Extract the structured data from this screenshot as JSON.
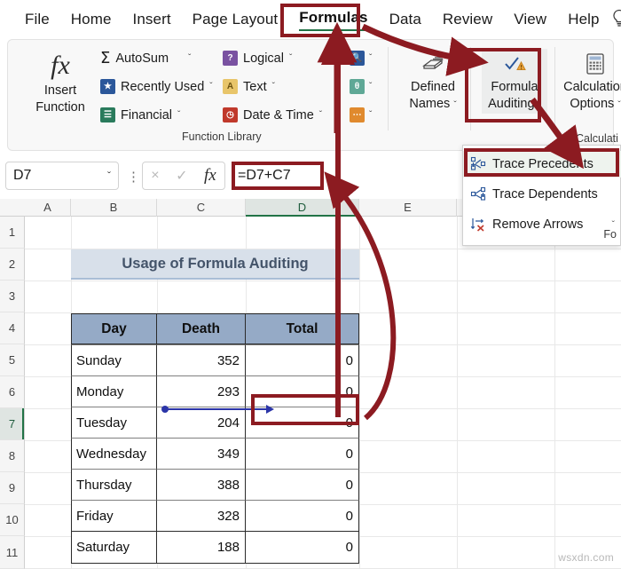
{
  "tabs": [
    {
      "label": "File",
      "active": false
    },
    {
      "label": "Home",
      "active": false
    },
    {
      "label": "Insert",
      "active": false
    },
    {
      "label": "Page Layout",
      "active": false
    },
    {
      "label": "Formulas",
      "active": true
    },
    {
      "label": "Data",
      "active": false
    },
    {
      "label": "Review",
      "active": false
    },
    {
      "label": "View",
      "active": false
    },
    {
      "label": "Help",
      "active": false
    }
  ],
  "help_icon": "lightbulb-icon",
  "ribbon": {
    "insert_function": {
      "line1": "Insert",
      "line2": "Function",
      "icon": "fx-icon"
    },
    "function_library": {
      "group_label": "Function Library",
      "buttons": [
        {
          "label": "AutoSum",
          "icon": "sigma-icon",
          "chevron": "ˇ"
        },
        {
          "label": "Recently Used",
          "icon": "star-icon",
          "chevron": "ˇ"
        },
        {
          "label": "Financial",
          "icon": "financial-icon",
          "chevron": "ˇ"
        },
        {
          "label": "Logical",
          "icon": "logical-icon",
          "chevron": "ˇ"
        },
        {
          "label": "Text",
          "icon": "text-icon",
          "chevron": "ˇ"
        },
        {
          "label": "Date & Time",
          "icon": "datetime-icon",
          "chevron": "ˇ"
        }
      ],
      "icon_only": [
        {
          "icon": "lookup-reference-icon",
          "chevron": "ˇ"
        },
        {
          "icon": "math-trig-icon",
          "chevron": "ˇ"
        },
        {
          "icon": "more-functions-icon",
          "chevron": "ˇ"
        }
      ]
    },
    "defined_names": {
      "line1": "Defined",
      "line2": "Names",
      "chevron": "ˇ",
      "icon": "defined-names-icon"
    },
    "formula_auditing": {
      "line1": "Formula",
      "line2": "Auditing",
      "chevron": "ˇ",
      "icon": "formula-auditing-icon",
      "group_label": "Fo"
    },
    "calculation": {
      "line1": "Calculation",
      "line2": "Options",
      "chevron": "ˇ",
      "icon": "calculator-icon",
      "group_label": "Calculati"
    }
  },
  "menu": {
    "items": [
      {
        "label": "Trace Precedents",
        "icon": "trace-precedents-icon",
        "highlighted": true,
        "chevron": ""
      },
      {
        "label": "Trace Dependents",
        "icon": "trace-dependents-icon",
        "highlighted": false,
        "chevron": ""
      },
      {
        "label": "Remove Arrows",
        "icon": "remove-arrows-icon",
        "highlighted": false,
        "chevron": "ˇ"
      }
    ],
    "footer": "Fo"
  },
  "formula_bar": {
    "name_box": "D7",
    "name_box_chevron": "ˇ",
    "cancel_icon": "×",
    "enter_icon": "✓",
    "fx_icon": "fx",
    "formula": "=D7+C7"
  },
  "grid": {
    "columns": [
      "A",
      "B",
      "C",
      "D",
      "E"
    ],
    "selected_column": "D",
    "rows": [
      "1",
      "2",
      "3",
      "4",
      "5",
      "6",
      "7",
      "8",
      "9",
      "10",
      "11"
    ],
    "selected_row": "7",
    "title_cell": "Usage of Formula Auditing",
    "table_headers": [
      "Day",
      "Death",
      "Total"
    ],
    "table_rows": [
      {
        "day": "Sunday",
        "death": "352",
        "total": "0"
      },
      {
        "day": "Monday",
        "death": "293",
        "total": "0"
      },
      {
        "day": "Tuesday",
        "death": "204",
        "total": "0"
      },
      {
        "day": "Wednesday",
        "death": "349",
        "total": "0"
      },
      {
        "day": "Thursday",
        "death": "388",
        "total": "0"
      },
      {
        "day": "Friday",
        "death": "328",
        "total": "0"
      },
      {
        "day": "Saturday",
        "death": "188",
        "total": "0"
      }
    ],
    "trace_arrow": {
      "from": "C7",
      "to": "D7",
      "color": "#2b35a8"
    }
  },
  "annotations": {
    "color": "#8c1b21",
    "boxes": [
      "formulas-tab",
      "formula-auditing-button",
      "formula-bar-formula",
      "trace-precedents-item",
      "cell-d7"
    ],
    "arrows": [
      "formulas-tab-to-formula-auditing",
      "formula-auditing-to-trace-precedents",
      "cell-d7-to-ribbon",
      "cell-d7-to-formula-bar",
      "insert-function-up"
    ]
  },
  "watermark": "wsxdn.com",
  "colors": {
    "accent_green": "#217346",
    "annotation_red": "#8c1b21",
    "table_header_bg": "#95aac6",
    "title_bg": "#d8e0ea",
    "title_text": "#44546a",
    "trace_blue": "#2b35a8"
  }
}
